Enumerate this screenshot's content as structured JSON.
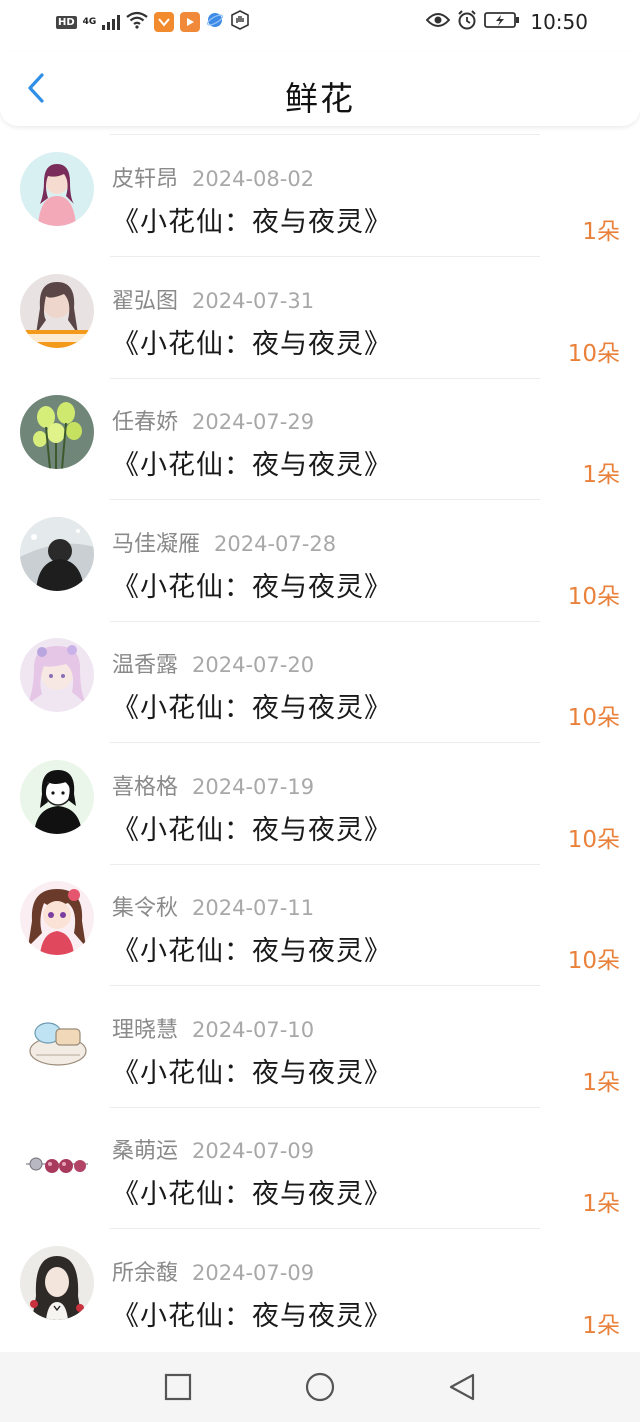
{
  "status_bar": {
    "hd": "HD",
    "network": "4G",
    "time": "10:50",
    "icons": [
      "hd-icon",
      "signal-icon",
      "wifi-icon",
      "app-badge-icon",
      "app-badge-icon",
      "browser-icon",
      "hand-icon",
      "eye-icon",
      "alarm-icon",
      "battery-charging-icon"
    ]
  },
  "header": {
    "title": "鲜花",
    "back_icon": "chevron-left-icon"
  },
  "colors": {
    "accent_blue": "#2f8fe6",
    "count_orange": "#e9813b",
    "date_gray": "#a8a8a8"
  },
  "rows": [
    {
      "name": "皮轩昂",
      "date": "2024-08-02",
      "gift": "《小花仙：夜与夜灵》",
      "count": "1朵"
    },
    {
      "name": "翟弘图",
      "date": "2024-07-31",
      "gift": "《小花仙：夜与夜灵》",
      "count": "10朵"
    },
    {
      "name": "任春娇",
      "date": "2024-07-29",
      "gift": "《小花仙：夜与夜灵》",
      "count": "1朵"
    },
    {
      "name": "马佳凝雁",
      "date": "2024-07-28",
      "gift": "《小花仙：夜与夜灵》",
      "count": "10朵"
    },
    {
      "name": "温香露",
      "date": "2024-07-20",
      "gift": "《小花仙：夜与夜灵》",
      "count": "10朵"
    },
    {
      "name": "喜格格",
      "date": "2024-07-19",
      "gift": "《小花仙：夜与夜灵》",
      "count": "10朵"
    },
    {
      "name": "集令秋",
      "date": "2024-07-11",
      "gift": "《小花仙：夜与夜灵》",
      "count": "10朵"
    },
    {
      "name": "理晓慧",
      "date": "2024-07-10",
      "gift": "《小花仙：夜与夜灵》",
      "count": "1朵"
    },
    {
      "name": "桑萌运",
      "date": "2024-07-09",
      "gift": "《小花仙：夜与夜灵》",
      "count": "1朵"
    },
    {
      "name": "所余馥",
      "date": "2024-07-09",
      "gift": "《小花仙：夜与夜灵》",
      "count": "1朵"
    }
  ],
  "nav_bar": {
    "icons": [
      "square-recents-icon",
      "circle-home-icon",
      "triangle-back-icon"
    ]
  }
}
